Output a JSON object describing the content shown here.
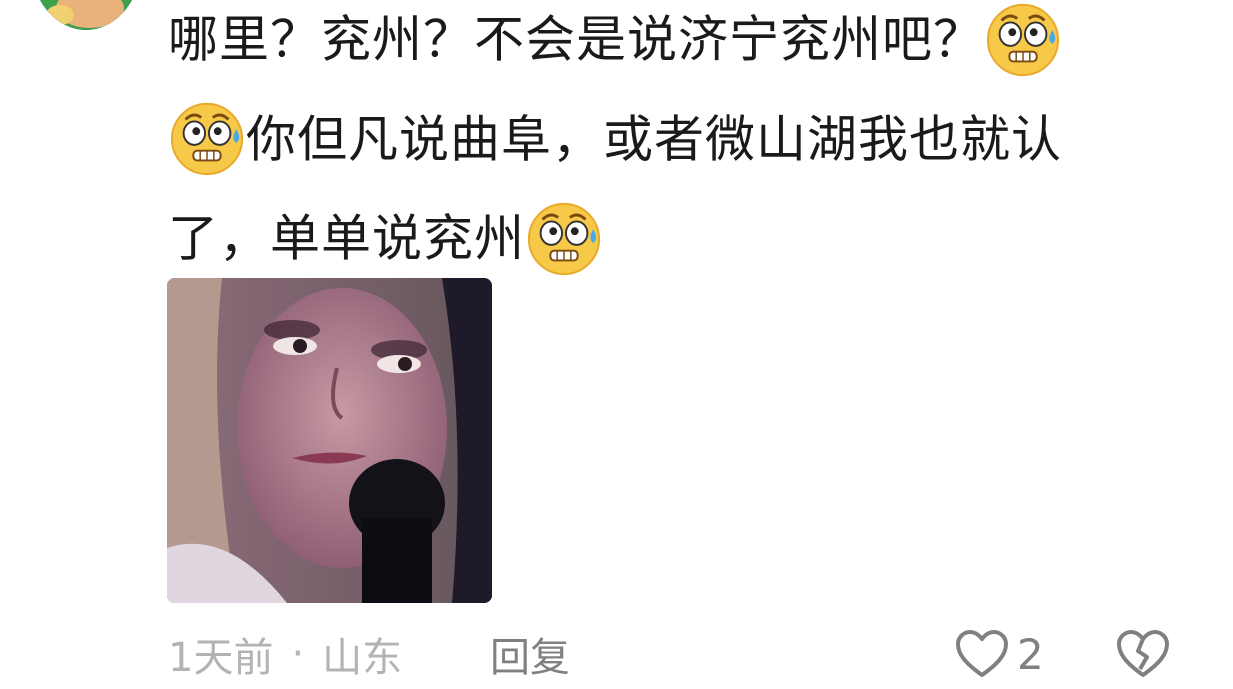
{
  "comment": {
    "segments": [
      {
        "type": "text",
        "value": "哪里？兖州？不会是说济宁兖州吧？"
      },
      {
        "type": "emoji",
        "icon": "anxious-sweat-emoji-icon"
      },
      {
        "type": "emoji",
        "icon": "anxious-sweat-emoji-icon"
      },
      {
        "type": "text",
        "value": "你但凡说曲阜，或者微山湖我也就认了，单单说兖州"
      },
      {
        "type": "emoji",
        "icon": "anxious-sweat-emoji-icon"
      }
    ],
    "text_line_1": "哪里？兖州？不会是说济宁兖州吧？",
    "text_line_2": "你但凡说曲阜，或者微山湖我也就认",
    "text_line_3": "了，单单说兖州"
  },
  "meta": {
    "time": "1天前",
    "separator": "·",
    "location": "山东",
    "reply_label": "回复"
  },
  "actions": {
    "like_count": "2",
    "like_icon": "heart-outline-icon",
    "dislike_icon": "broken-heart-icon"
  },
  "colors": {
    "text": "#1a1a1a",
    "meta": "#b3b3b3",
    "action": "#808080",
    "emoji_face": "#f7c948"
  }
}
